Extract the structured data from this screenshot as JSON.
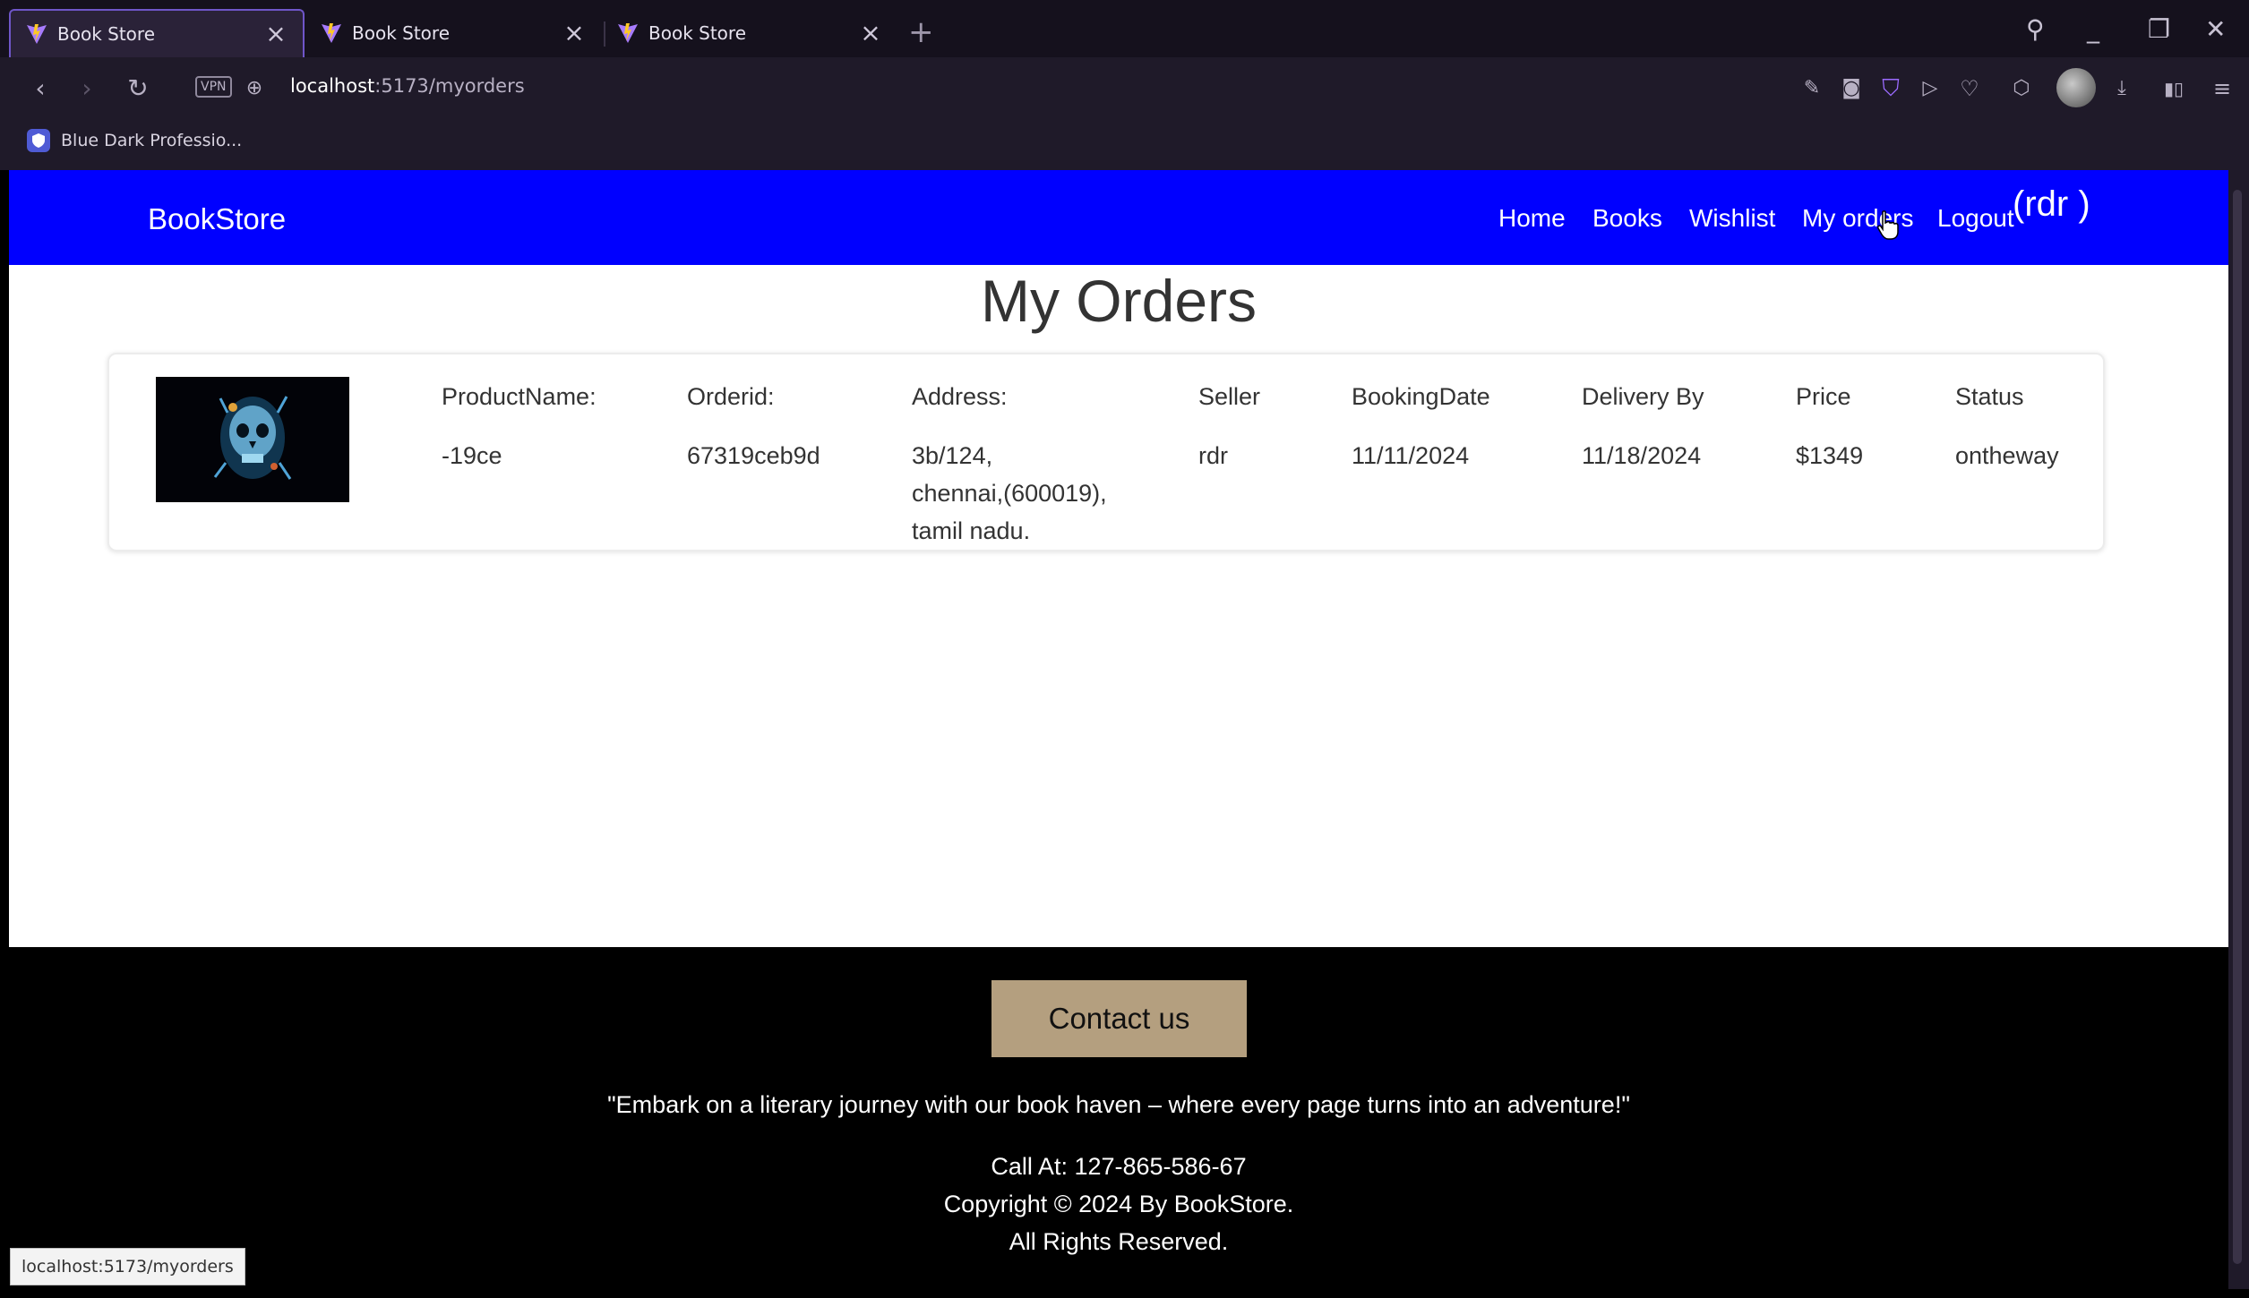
{
  "browser": {
    "tabs": [
      {
        "title": "Book Store",
        "active": true
      },
      {
        "title": "Book Store",
        "active": false
      },
      {
        "title": "Book Store",
        "active": false
      }
    ],
    "url": {
      "host": "localhost",
      "path": ":5173/myorders"
    },
    "vpn_label": "VPN",
    "bookmark": "Blue Dark Professio...",
    "status_url": "localhost:5173/myorders",
    "icons": [
      "back-icon",
      "forward-icon",
      "reload-icon",
      "globe-icon",
      "search-icon",
      "minimize-icon",
      "restore-icon",
      "close-icon",
      "edit-icon",
      "camera-icon",
      "shield-icon",
      "send-icon",
      "heart-icon",
      "cube-icon",
      "download-icon",
      "battery-icon",
      "menu-icon"
    ]
  },
  "navbar": {
    "brand": "BookStore",
    "links": {
      "home": "Home",
      "books": "Books",
      "wishlist": "Wishlist",
      "my_orders": "My orders",
      "logout": "Logout"
    },
    "user": "(rdr )",
    "color": "#0000ff"
  },
  "page": {
    "title": "My Orders"
  },
  "order": {
    "headers": {
      "product_name": "ProductName:",
      "order_id": "Orderid:",
      "address": "Address:",
      "seller": "Seller",
      "booking_date": "BookingDate",
      "delivery_by": "Delivery By",
      "price": "Price",
      "status": "Status"
    },
    "values": {
      "product_name": "-19ce",
      "order_id": "67319ceb9d",
      "address_line1": "3b/124,",
      "address_line2": "chennai,(600019),",
      "address_line3": "tamil nadu.",
      "seller": "rdr",
      "booking_date": "11/11/2024",
      "delivery_by": "11/18/2024",
      "price": "$1349",
      "status": "ontheway"
    }
  },
  "footer": {
    "contact_button": "Contact us",
    "contact_color": "#b49f7f",
    "tagline": "\"Embark on a literary journey with our book haven – where every page turns into an adventure!\"",
    "phone": "Call At: 127-865-586-67",
    "copyright": "Copyright © 2024 By BookStore.",
    "rights": "All Rights Reserved."
  }
}
